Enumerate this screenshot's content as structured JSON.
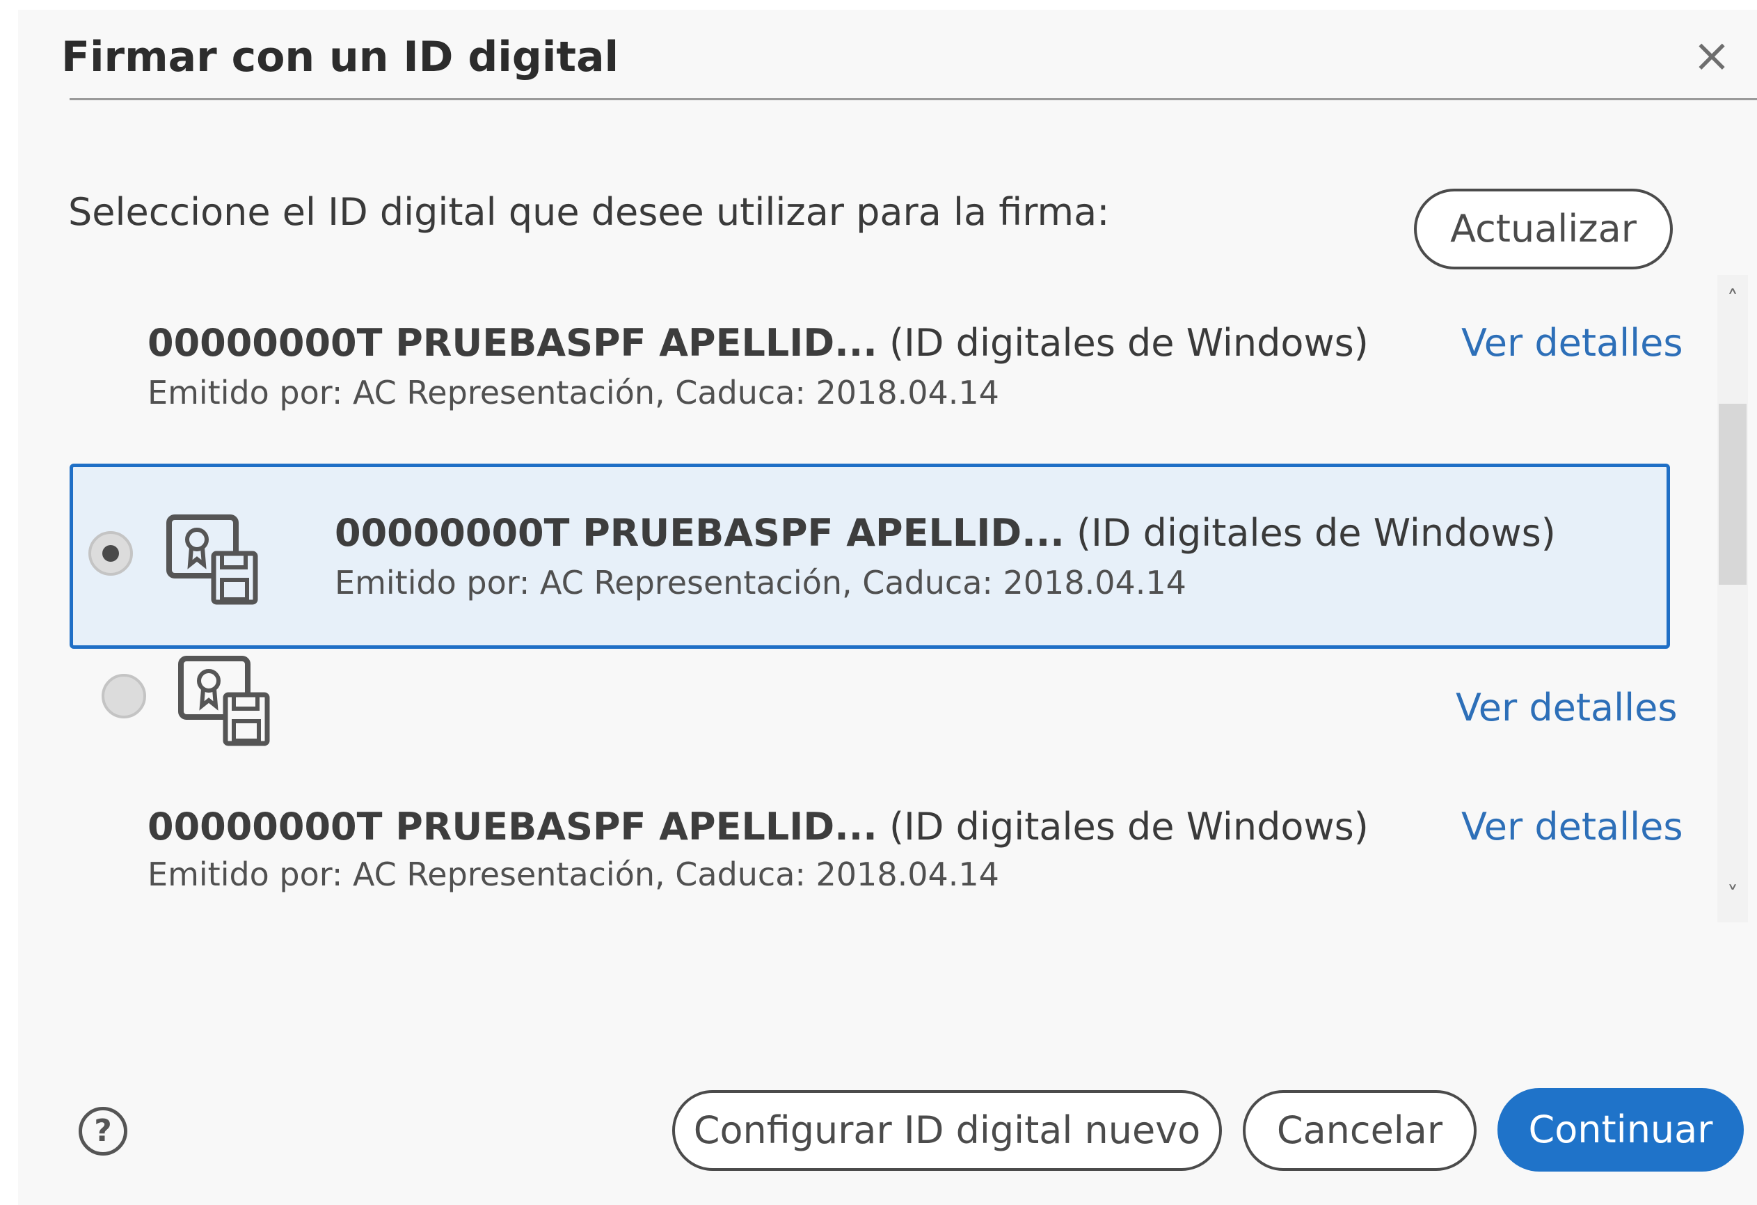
{
  "dialog": {
    "title": "Firmar con un ID digital",
    "close_symbol": "×",
    "prompt": "Seleccione el ID digital que desee utilizar para la firma:",
    "refresh_label": "Actualizar"
  },
  "ids": [
    {
      "name": "00000000T PRUEBASPF APELLID...",
      "source": "(ID digitales de Windows)",
      "issued": "Emitido por: AC Representación, Caduca: 2018.04.14",
      "details_label": "Ver detalles",
      "selected": false
    },
    {
      "name": "00000000T PRUEBASPF APELLID...",
      "source": "(ID digitales de Windows)",
      "issued": "Emitido por: AC Representación, Caduca: 2018.04.14",
      "selected": true
    },
    {
      "details_label": "Ver detalles",
      "selected": false
    },
    {
      "name": "00000000T PRUEBASPF APELLID...",
      "source": "(ID digitales de Windows)",
      "issued": "Emitido por: AC Representación, Caduca: 2018.04.14",
      "details_label": "Ver detalles",
      "selected": false
    }
  ],
  "scrollbar": {
    "up_symbol": "˄",
    "down_symbol": "˅"
  },
  "footer": {
    "help_symbol": "?",
    "configure_label": "Configurar ID digital nuevo",
    "cancel_label": "Cancelar",
    "continue_label": "Continuar"
  },
  "icons": {
    "cert": "certificate-icon",
    "help": "help-icon",
    "close": "close-icon"
  },
  "colors": {
    "accent": "#1f73c9",
    "link": "#2d6fb8",
    "selection_bg": "#e7f0f9",
    "selection_border": "#1f6fc6"
  }
}
